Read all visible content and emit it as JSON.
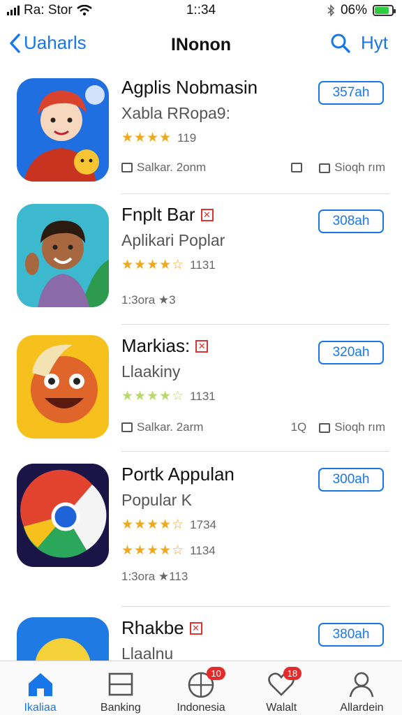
{
  "status_bar": {
    "carrier": "Ra: Stor",
    "time": "1::34",
    "battery_text": "06%"
  },
  "nav": {
    "back_label": "Uaharls",
    "title": "INonon",
    "right_label": "Hyt"
  },
  "apps": [
    {
      "name": "Agplis Nobmasin",
      "subtitle": "Xabla RRopa9:",
      "stars": "★★★★",
      "rating_count": "119",
      "meta_left": "Salkar. 2onm",
      "meta_mid": "",
      "meta_right": "Sioqh rım",
      "button": "357ah",
      "flag": ""
    },
    {
      "name": "Fnplt Bar",
      "subtitle": "Aplikari Poplar",
      "stars": "★★★★☆",
      "rating_count": "1131",
      "meta_left": "1:3ora ★3",
      "meta_mid": "",
      "meta_right": "",
      "button": "308ah",
      "flag": "✕"
    },
    {
      "name": "Markias:",
      "subtitle": "Llaakiny",
      "stars": "★★★★☆",
      "rating_count": "1131",
      "meta_left": "Salkar. 2arm",
      "meta_mid": "1Q",
      "meta_right": "Sioqh rım",
      "button": "320ah",
      "flag": "✕"
    },
    {
      "name": "Portk Appulan",
      "subtitle": "Popular K",
      "stars": "★★★★☆",
      "rating_count": "1734",
      "stars2": "★★★★☆",
      "rating_count2": "1134",
      "meta_left": "1:3ora ★113",
      "meta_mid": "",
      "meta_right": "",
      "button": "300ah",
      "flag": ""
    },
    {
      "name": "Rhakbe",
      "subtitle": "Llaalnu",
      "button": "380ah",
      "flag": "✕"
    }
  ],
  "tabs": [
    {
      "label": "Ikaliaa",
      "icon": "home-icon",
      "badge": ""
    },
    {
      "label": "Banking",
      "icon": "card-icon",
      "badge": ""
    },
    {
      "label": "Indonesia",
      "icon": "globe-icon",
      "badge": "10"
    },
    {
      "label": "Walalt",
      "icon": "heart-icon",
      "badge": "18"
    },
    {
      "label": "Allardein",
      "icon": "person-icon",
      "badge": ""
    }
  ],
  "colors": {
    "accent": "#1877e8",
    "badge": "#e32b2b",
    "star": "#f0a91b"
  }
}
